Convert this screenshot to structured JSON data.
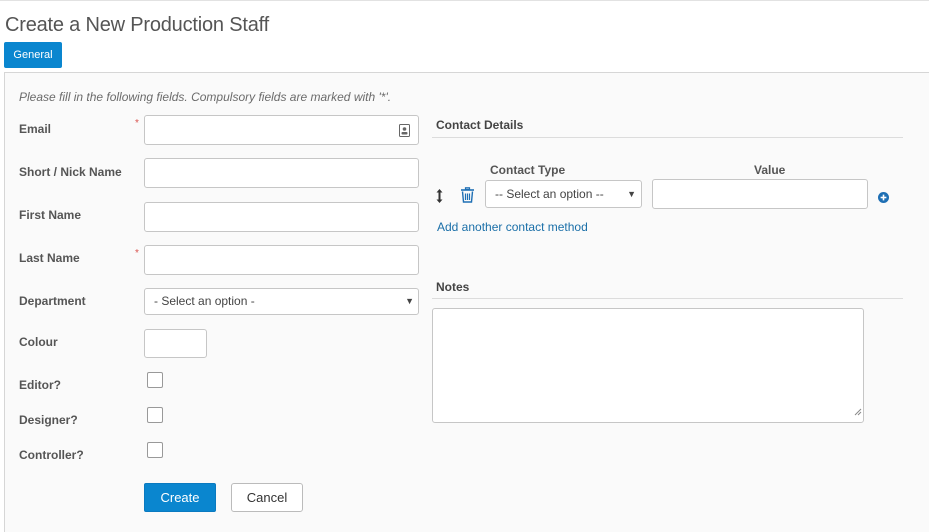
{
  "page_title": "Create a New Production Staff",
  "tabs": [
    {
      "label": "General",
      "active": true
    }
  ],
  "hint": "Please fill in the following fields. Compulsory fields are marked with '*'.",
  "required_marker": "*",
  "fields": {
    "email": {
      "label": "Email",
      "value": "",
      "required": true,
      "icon": "contact-card-icon"
    },
    "short_name": {
      "label": "Short / Nick Name",
      "value": ""
    },
    "first_name": {
      "label": "First Name",
      "value": ""
    },
    "last_name": {
      "label": "Last Name",
      "value": "",
      "required": true
    },
    "department": {
      "label": "Department",
      "selected": "- Select an option -"
    },
    "colour": {
      "label": "Colour",
      "value": ""
    },
    "editor": {
      "label": "Editor?",
      "checked": false
    },
    "designer": {
      "label": "Designer?",
      "checked": false
    },
    "controller": {
      "label": "Controller?",
      "checked": false
    }
  },
  "buttons": {
    "create": "Create",
    "cancel": "Cancel"
  },
  "contact_details": {
    "title": "Contact Details",
    "col_type": "Contact Type",
    "col_value": "Value",
    "rows": [
      {
        "type": "-- Select an option --",
        "value": ""
      }
    ],
    "add_link": "Add another contact method"
  },
  "notes": {
    "title": "Notes",
    "value": ""
  },
  "colors": {
    "accent": "#0a86cf",
    "required": "#d9534f",
    "link": "#1a6fa8"
  },
  "icons": [
    "contact-card-icon",
    "drag-handle-icon",
    "trash-icon",
    "add-circle-icon",
    "caret-down-icon"
  ]
}
